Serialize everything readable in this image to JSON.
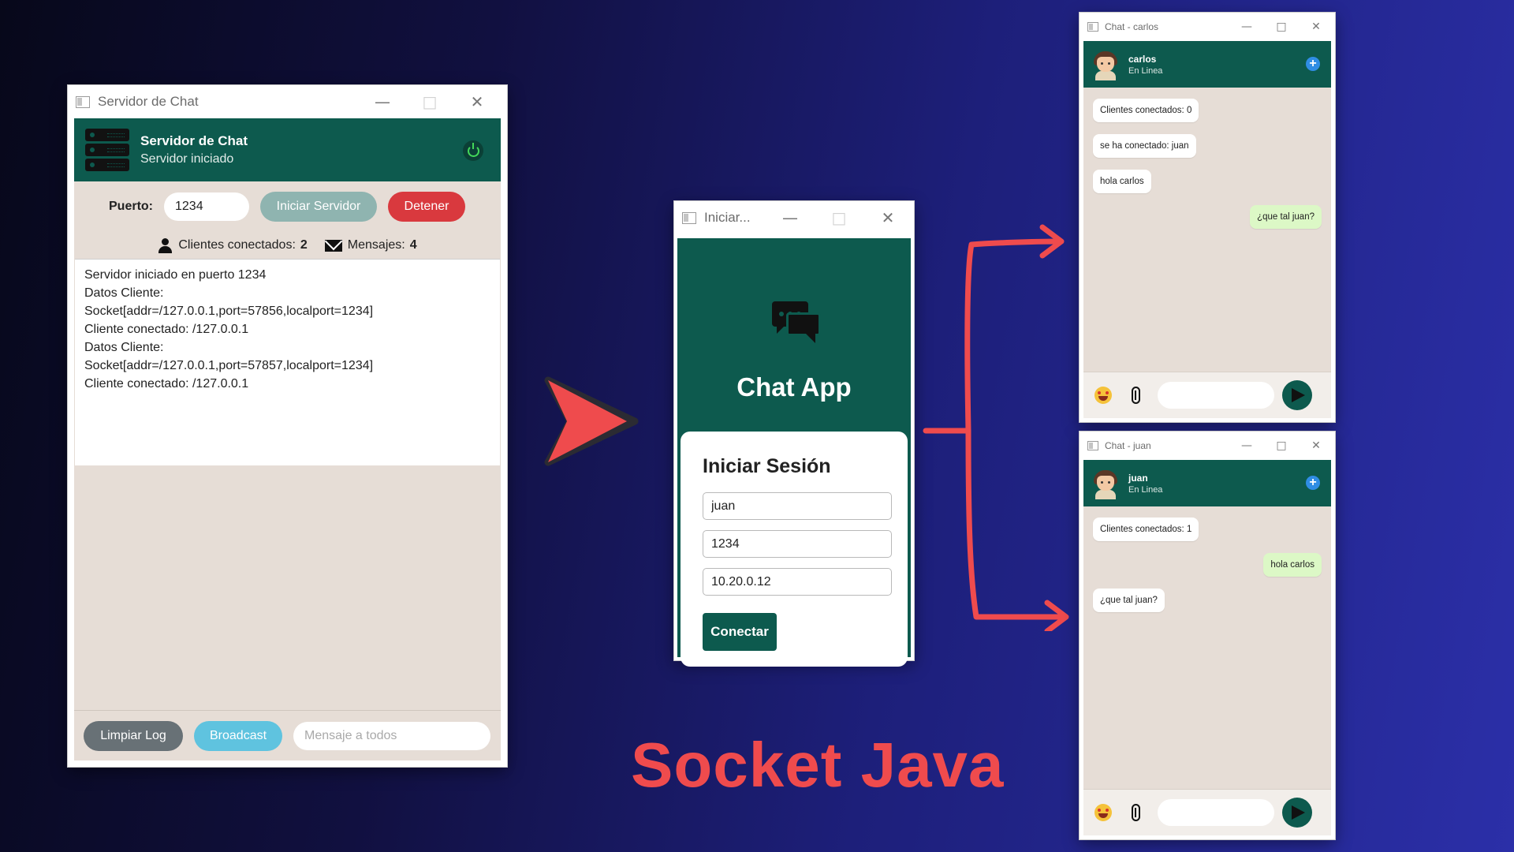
{
  "slogan": "Socket Java",
  "colors": {
    "teal": "#0d5a4e",
    "red": "#ef4b4d",
    "stop_red": "#d9393e",
    "broadcast": "#5fc3df"
  },
  "server_window": {
    "title": "Servidor de Chat",
    "header_title": "Servidor de Chat",
    "header_status": "Servidor iniciado",
    "port_label": "Puerto:",
    "port_value": "1234",
    "start_button": "Iniciar Servidor",
    "stop_button": "Detener",
    "clients_label": "Clientes conectados:",
    "clients_count": "2",
    "messages_label": "Mensajes:",
    "messages_count": "4",
    "log": "Servidor iniciado en puerto 1234\nDatos Cliente:\nSocket[addr=/127.0.0.1,port=57856,localport=1234]\nCliente conectado: /127.0.0.1\nDatos Cliente:\nSocket[addr=/127.0.0.1,port=57857,localport=1234]\nCliente conectado: /127.0.0.1",
    "clear_button": "Limpiar Log",
    "broadcast_button": "Broadcast",
    "broadcast_placeholder": "Mensaje a todos"
  },
  "login_window": {
    "title": "Iniciar...",
    "app_name": "Chat App",
    "heading": "Iniciar Sesión",
    "username": "juan",
    "port": "1234",
    "host": "10.20.0.12",
    "connect_button": "Conectar"
  },
  "chat_windows": [
    {
      "title": "Chat - carlos",
      "user": "carlos",
      "status": "En Linea",
      "messages": [
        {
          "text": "Clientes conectados: 0",
          "dir": "in"
        },
        {
          "text": "se ha conectado: juan",
          "dir": "in"
        },
        {
          "text": "hola carlos",
          "dir": "in"
        },
        {
          "text": "¿que tal juan?",
          "dir": "out"
        }
      ]
    },
    {
      "title": "Chat - juan",
      "user": "juan",
      "status": "En Linea",
      "messages": [
        {
          "text": "Clientes conectados: 1",
          "dir": "in"
        },
        {
          "text": "hola carlos",
          "dir": "out"
        },
        {
          "text": "¿que tal juan?",
          "dir": "in"
        }
      ]
    }
  ]
}
